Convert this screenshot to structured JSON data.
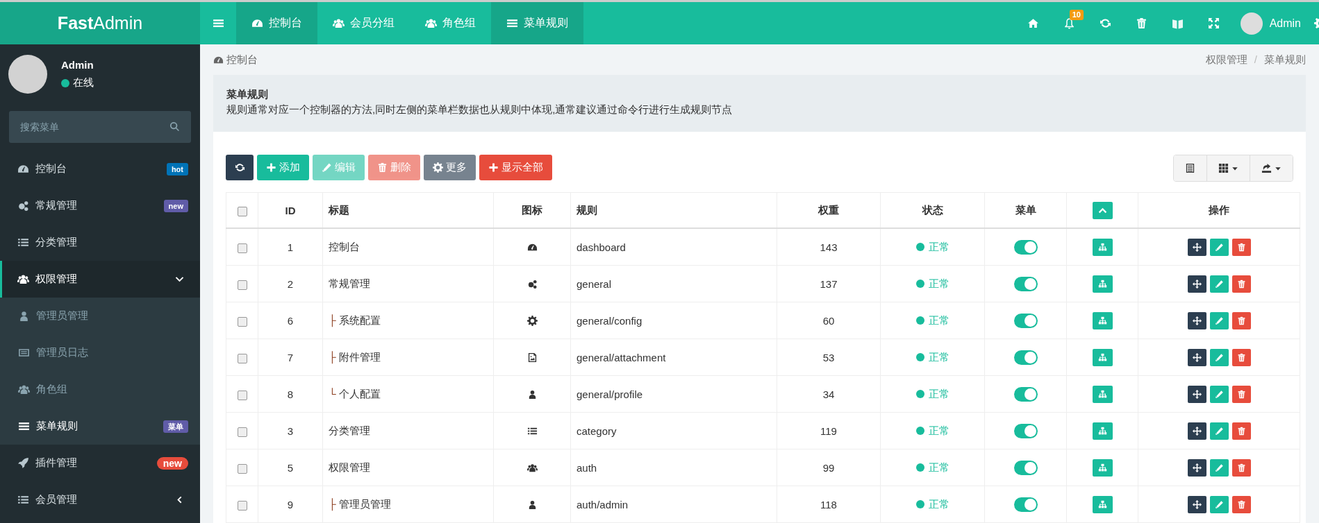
{
  "header": {
    "logo": "**Fast**Admin",
    "nav_tabs": [
      {
        "label": "控制台",
        "selected": true
      },
      {
        "label": "会员分组",
        "selected": false
      },
      {
        "label": "角色组",
        "selected": false
      },
      {
        "label": "菜单规则",
        "selected": true
      }
    ],
    "notification_count": "10",
    "user_name": "Admin"
  },
  "sidebar": {
    "user": {
      "name": "Admin",
      "status": "在线"
    },
    "search": {
      "placeholder": "搜索菜单"
    },
    "items": [
      {
        "label": "控制台",
        "selected": false,
        "badge": {
          "text": "hot",
          "color": "#0073b7",
          "kind": "label"
        }
      },
      {
        "label": "常规管理",
        "selected": false,
        "badge": {
          "text": "new",
          "color": "#605ca8",
          "kind": "label"
        }
      },
      {
        "label": "分类管理",
        "selected": false
      },
      {
        "label": "权限管理",
        "selected": true,
        "expanded": true,
        "children": [
          {
            "label": "管理员管理",
            "selected": false
          },
          {
            "label": "管理员日志",
            "selected": false
          },
          {
            "label": "角色组",
            "selected": false
          },
          {
            "label": "菜单规则",
            "selected": true,
            "badge": {
              "text": "菜单",
              "color": "#605ca8",
              "kind": "label"
            }
          }
        ]
      },
      {
        "label": "插件管理",
        "selected": false,
        "badge": {
          "text": "new",
          "color": "#e74c3c",
          "kind": "pill"
        }
      },
      {
        "label": "会员管理",
        "selected": false,
        "expanded": false
      }
    ]
  },
  "content": {
    "page_title": "控制台",
    "breadcrumb": [
      "权限管理",
      "菜单规则"
    ],
    "breadcrumb_separator": "/",
    "panel": {
      "title": "菜单规则",
      "description": "规则通常对应一个控制器的方法,同时左侧的菜单栏数据也从规则中体现,通常建议通过命令行进行生成规则节点"
    },
    "toolbar": [
      {
        "kind": "refresh",
        "disabled": false
      },
      {
        "kind": "add",
        "label": "添加",
        "disabled": false
      },
      {
        "kind": "edit",
        "label": "编辑",
        "disabled": true
      },
      {
        "kind": "delete",
        "label": "删除",
        "disabled": true
      },
      {
        "kind": "more",
        "label": "更多",
        "disabled": false
      },
      {
        "kind": "show_all",
        "label": "显示全部",
        "disabled": false
      }
    ],
    "table": {
      "columns": [
        {
          "kind": "checkbox",
          "checked": false
        },
        {
          "kind": "text",
          "label": "ID"
        },
        {
          "kind": "text",
          "label": "标题"
        },
        {
          "kind": "text",
          "label": "图标"
        },
        {
          "kind": "text",
          "label": "规则"
        },
        {
          "kind": "text",
          "label": "权重"
        },
        {
          "kind": "text",
          "label": "状态"
        },
        {
          "kind": "text",
          "label": "菜单"
        },
        {
          "kind": "collapse_button"
        },
        {
          "kind": "text",
          "label": "操作"
        }
      ],
      "rows": [
        {
          "checked": false,
          "id": "1",
          "title": "控制台",
          "rule": "dashboard",
          "weight": "143",
          "status": "正常",
          "menu_on": true
        },
        {
          "checked": false,
          "id": "2",
          "title": "常规管理",
          "rule": "general",
          "weight": "137",
          "status": "正常",
          "menu_on": true,
          "children": [
            {
              "checked": false,
              "id": "6",
              "prefix": "├",
              "title": "系统配置",
              "rule": "general/config",
              "weight": "60",
              "status": "正常",
              "menu_on": true
            },
            {
              "checked": false,
              "id": "7",
              "prefix": "├",
              "title": "附件管理",
              "rule": "general/attachment",
              "weight": "53",
              "status": "正常",
              "menu_on": true
            },
            {
              "checked": false,
              "id": "8",
              "prefix": "└",
              "title": "个人配置",
              "rule": "general/profile",
              "weight": "34",
              "status": "正常",
              "menu_on": true
            }
          ]
        },
        {
          "checked": false,
          "id": "3",
          "title": "分类管理",
          "rule": "category",
          "weight": "119",
          "status": "正常",
          "menu_on": true
        },
        {
          "checked": false,
          "id": "5",
          "title": "权限管理",
          "rule": "auth",
          "weight": "99",
          "status": "正常",
          "menu_on": true,
          "children": [
            {
              "checked": false,
              "id": "9",
              "prefix": "├",
              "title": "管理员管理",
              "rule": "auth/admin",
              "weight": "118",
              "status": "正常",
              "menu_on": true
            }
          ]
        }
      ]
    }
  }
}
